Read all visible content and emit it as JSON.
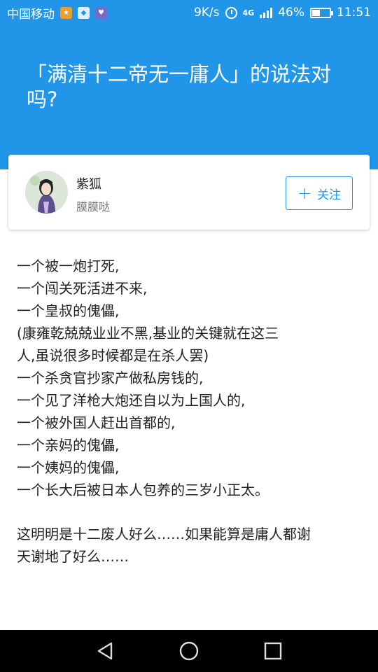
{
  "status_bar": {
    "carrier": "中国移动",
    "speed": "9K/s",
    "network_type": "4G",
    "battery": "46%",
    "battery_level": 0.46,
    "time": "11:51",
    "background_color": "#2196e8"
  },
  "question": {
    "title": "「满清十二帝无一庸人」的说法对吗?"
  },
  "author": {
    "name": "紫狐",
    "bio": "膜膜哒",
    "follow_label": "关注",
    "accent_color": "#2196e8"
  },
  "answer": {
    "lines": [
      "一个被一炮打死,",
      "一个闯关死活进不来,",
      "一个皇叔的傀儡,",
      "(康雍乾兢兢业业不黑,基业的关键就在这三",
      "人,虽说很多时候都是在杀人罢)",
      "一个杀贪官抄家产做私房钱的,",
      "一个见了洋枪大炮还自以为上国人的,",
      "一个被外国人赶出首都的,",
      "一个亲妈的傀儡,",
      "一个姨妈的傀儡,",
      "一个长大后被日本人包养的三岁小正太。"
    ],
    "closing_lines": [
      "这明明是十二废人好么……如果能算是庸人都谢",
      "天谢地了好么……"
    ]
  },
  "navigation": {
    "icons": [
      "back-icon",
      "home-icon",
      "recents-icon"
    ]
  }
}
